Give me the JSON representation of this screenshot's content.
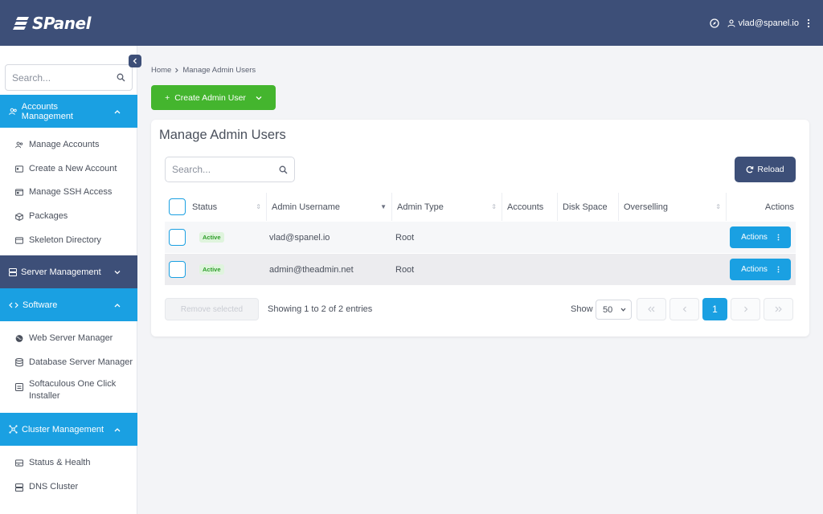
{
  "app": {
    "logo_text": "SPanel",
    "user_email": "vlad@spanel.io",
    "colors": {
      "navy": "#3d4f78",
      "blue": "#1aa0e2",
      "green": "#44b52e"
    }
  },
  "sidebar": {
    "search_placeholder": "Search...",
    "sections": [
      {
        "label": "Accounts Management",
        "icon": "users-icon",
        "items": [
          "Manage Accounts",
          "Create a New Account",
          "Manage SSH Access",
          "Packages",
          "Skeleton Directory"
        ]
      },
      {
        "label": "Server Management",
        "icon": "server-icon",
        "items": []
      },
      {
        "label": "Software",
        "icon": "code-icon",
        "items": [
          "Web Server Manager",
          "Database Server Manager",
          "Softaculous One Click Installer"
        ]
      },
      {
        "label": "Cluster Management",
        "icon": "cluster-icon",
        "items": [
          "Status & Health",
          "DNS Cluster"
        ]
      }
    ]
  },
  "breadcrumb": {
    "home": "Home",
    "current": "Manage Admin Users"
  },
  "create_button": "Create Admin User",
  "card": {
    "title": "Manage Admin Users",
    "search_placeholder": "Search...",
    "reload_label": "Reload"
  },
  "table": {
    "headers": [
      "Status",
      "Admin Username",
      "Admin Type",
      "Accounts",
      "Disk Space",
      "Overselling",
      "Actions"
    ],
    "rows": [
      {
        "status": "Active",
        "username": "vlad@spanel.io",
        "type": "Root",
        "accounts": "",
        "disk_space": "",
        "overselling": "",
        "action_label": "Actions"
      },
      {
        "status": "Active",
        "username": "admin@theadmin.net",
        "type": "Root",
        "accounts": "",
        "disk_space": "",
        "overselling": "",
        "action_label": "Actions"
      }
    ]
  },
  "footer": {
    "remove_label": "Remove selected",
    "entries_text": "Showing 1 to 2 of 2 entries",
    "show_label": "Show",
    "page_size": "50",
    "current_page": "1"
  }
}
